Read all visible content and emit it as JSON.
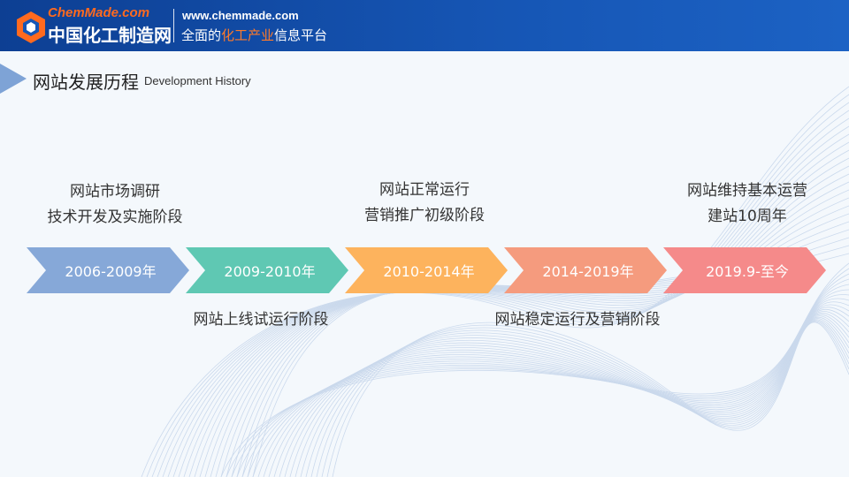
{
  "header": {
    "logo_en": "ChemMade.com",
    "logo_cn": "中国化工制造网",
    "url": "www.chemmade.com",
    "slogan_pre": "全面的",
    "slogan_hl": "化工产业",
    "slogan_post": "信息平台",
    "brand_color": "#1656b5",
    "accent_color": "#ff6a1f"
  },
  "title": {
    "cn": "网站发展历程",
    "en": "Development History"
  },
  "timeline": {
    "stages": [
      {
        "label": "2006-2009年",
        "color": "#86a8d8"
      },
      {
        "label": "2009-2010年",
        "color": "#5fc8b3"
      },
      {
        "label": "2010-2014年",
        "color": "#fdb35d"
      },
      {
        "label": "2014-2019年",
        "color": "#f59b7e"
      },
      {
        "label": "2019.9-至今",
        "color": "#f58a8a"
      }
    ],
    "captions": {
      "stage1": [
        "网站市场调研",
        "技术开发及实施阶段"
      ],
      "stage2": [
        "网站上线试运行阶段"
      ],
      "stage3": [
        "网站正常运行",
        "营销推广初级阶段"
      ],
      "stage4": [
        "网站稳定运行及营销阶段"
      ],
      "stage5": [
        "网站维持基本运营",
        "建站10周年"
      ]
    }
  }
}
